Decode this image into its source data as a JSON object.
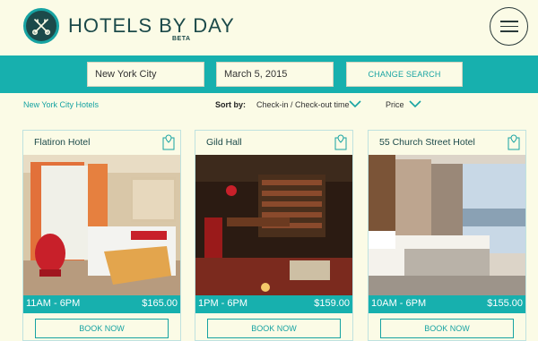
{
  "header": {
    "brand": "HOTELS BY DAY",
    "beta": "BETA",
    "logo_icon": "crossed-keys-icon",
    "menu_icon": "hamburger-icon"
  },
  "search": {
    "city": "New York City",
    "date": "March 5, 2015",
    "change_label": "CHANGE SEARCH"
  },
  "filters": {
    "breadcrumb": "New York City Hotels",
    "sort_by_label": "Sort by:",
    "sort_options": [
      {
        "label": "Check-in / Check-out time",
        "icon": "chevron-down-icon"
      },
      {
        "label": "Price",
        "icon": "chevron-down-icon"
      }
    ]
  },
  "hotels": [
    {
      "name": "Flatiron Hotel",
      "hours": "11AM - 6PM",
      "price": "$165.00",
      "book_label": "BOOK NOW",
      "map_icon": "map-pin-icon"
    },
    {
      "name": "Gild Hall",
      "hours": "1PM - 6PM",
      "price": "$159.00",
      "book_label": "BOOK NOW",
      "map_icon": "map-pin-icon"
    },
    {
      "name": "55 Church Street Hotel",
      "hours": "10AM - 6PM",
      "price": "$155.00",
      "book_label": "BOOK NOW",
      "map_icon": "map-pin-icon"
    }
  ],
  "colors": {
    "accent": "#17b0ae",
    "background": "#fbfbe6",
    "dark": "#1c4a4a"
  }
}
